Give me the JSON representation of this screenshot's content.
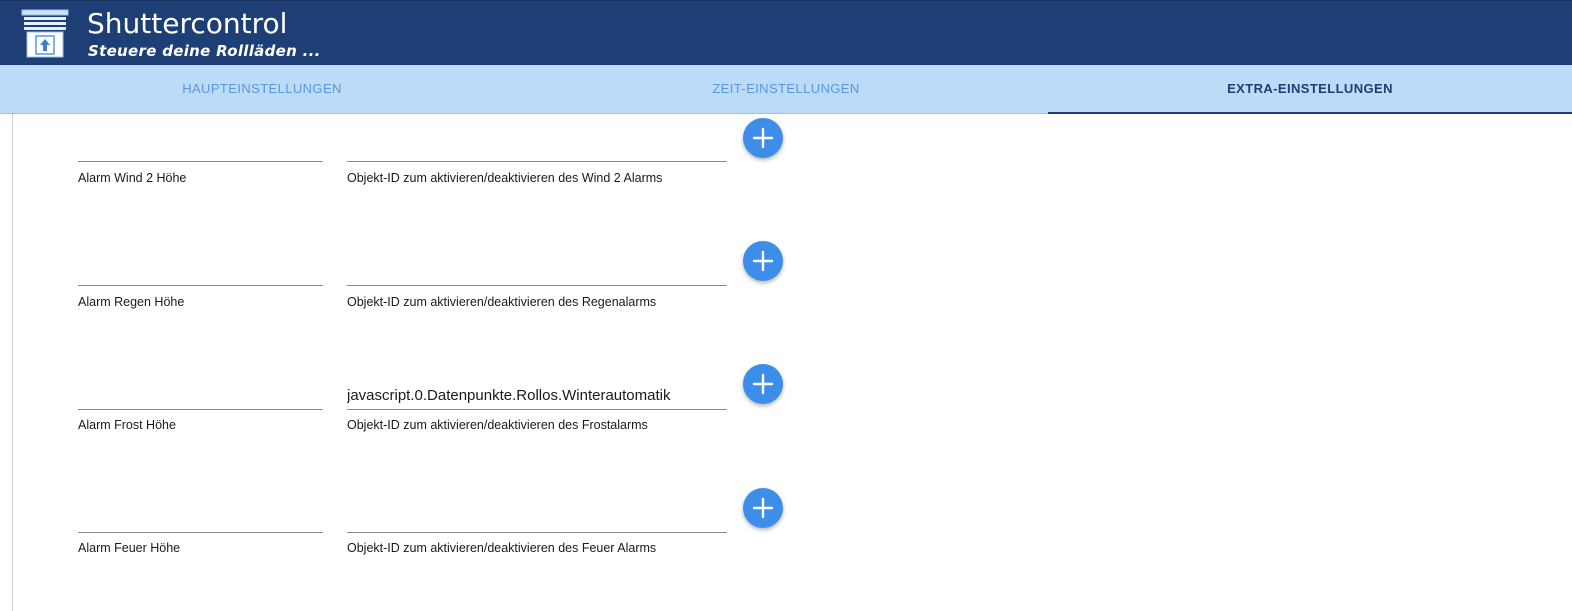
{
  "app": {
    "title": "Shuttercontrol",
    "subtitle": "Steuere deine Rollläden ..."
  },
  "tabs": [
    {
      "label": "HAUPTEINSTELLUNGEN",
      "active": false
    },
    {
      "label": "ZEIT-EINSTELLUNGEN",
      "active": false
    },
    {
      "label": "EXTRA-EINSTELLUNGEN",
      "active": true
    }
  ],
  "alarms": [
    {
      "height_label": "Alarm Wind 2 Höhe",
      "height_value": "",
      "object_label": "Objekt-ID zum aktivieren/deaktivieren des Wind 2 Alarms",
      "object_value": ""
    },
    {
      "height_label": "Alarm Regen Höhe",
      "height_value": "",
      "object_label": "Objekt-ID zum aktivieren/deaktivieren des Regenalarms",
      "object_value": ""
    },
    {
      "height_label": "Alarm Frost Höhe",
      "height_value": "",
      "object_label": "Objekt-ID zum aktivieren/deaktivieren des Frostalarms",
      "object_value": "javascript.0.Datenpunkte.Rollos.Winterautomatik"
    },
    {
      "height_label": "Alarm Feuer Höhe",
      "height_value": "",
      "object_label": "Objekt-ID zum aktivieren/deaktivieren des Feuer Alarms",
      "object_value": ""
    }
  ],
  "icons": {
    "logo": "shutter-logo-icon",
    "add": "plus-icon"
  },
  "colors": {
    "header": "#1e3f75",
    "tabbar": "#bcdbf9",
    "tab_inactive": "#5b97d8",
    "tab_active": "#1f3f73",
    "add_button": "#3d8ee8"
  }
}
